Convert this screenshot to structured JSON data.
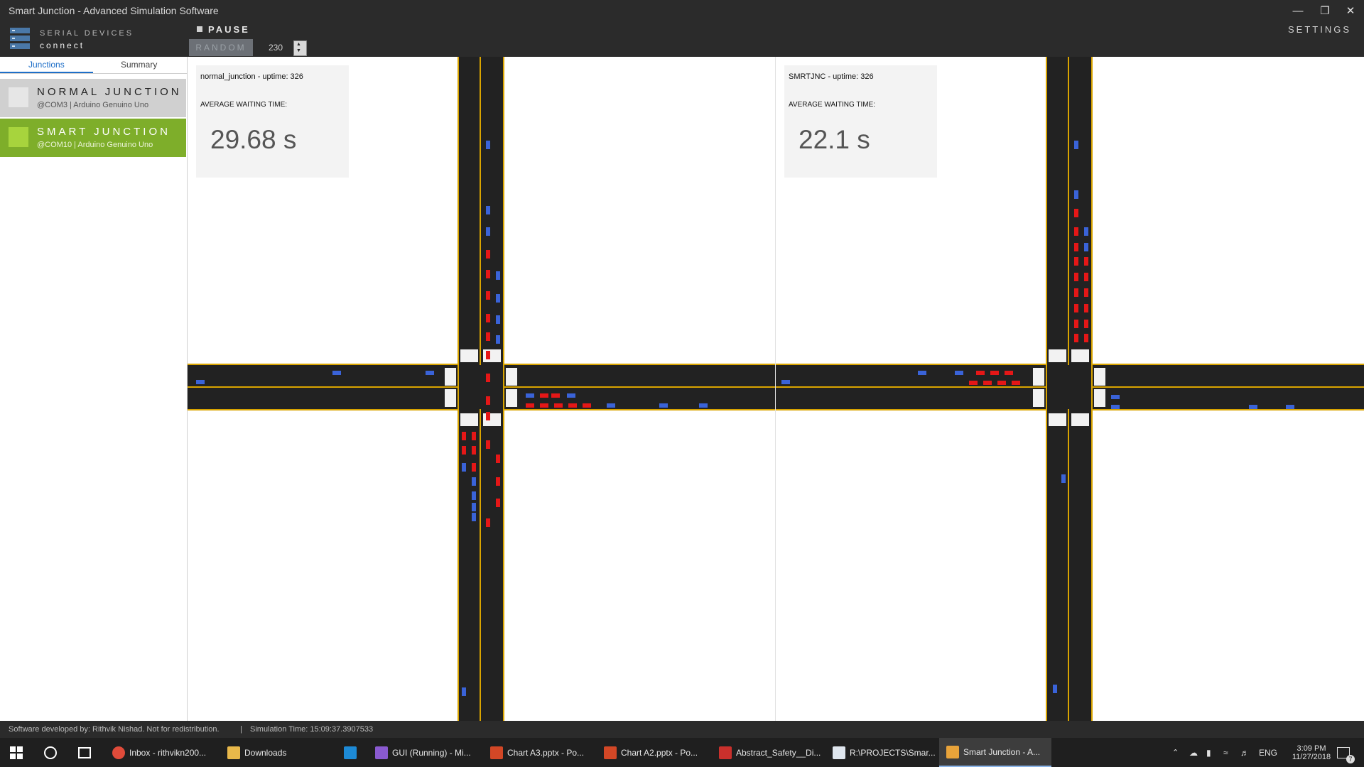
{
  "window": {
    "title": "Smart Junction - Advanced Simulation Software"
  },
  "toolbar": {
    "serial_label": "SERIAL DEVICES",
    "connect_label": "connect",
    "pause_label": "PAUSE",
    "random_label": "RANDOM",
    "count_value": "230",
    "settings_label": "SETTINGS"
  },
  "sidebar": {
    "tabs": [
      {
        "label": "Junctions"
      },
      {
        "label": "Summary"
      }
    ],
    "junctions": [
      {
        "name": "NORMAL JUNCTION",
        "subtitle": "@COM3 | Arduino Genuino Uno"
      },
      {
        "name": "SMART JUNCTION",
        "subtitle": "@COM10 | Arduino Genuino Uno"
      }
    ]
  },
  "panels": [
    {
      "uptime": "normal_junction - uptime: 326",
      "avg_label": "AVERAGE WAITING TIME:",
      "value": "29.68 s"
    },
    {
      "uptime": "SMRTJNC - uptime: 326",
      "avg_label": "AVERAGE WAITING TIME:",
      "value": "22.1 s"
    }
  ],
  "statusbar": {
    "dev_text": "Software developed by: Rithvik Nishad. Not for redistribution.",
    "separator": "|",
    "sim_time": "Simulation Time:  15:09:37.3907533"
  },
  "taskbar": {
    "items": [
      {
        "label": "Inbox - rithvikn200...",
        "icon": "chrome-icon"
      },
      {
        "label": "Downloads",
        "icon": "folder-icon"
      },
      {
        "label": "",
        "icon": "vscode-icon"
      },
      {
        "label": "GUI (Running) - Mi...",
        "icon": "visual-studio-icon"
      },
      {
        "label": "Chart A3.pptx - Po...",
        "icon": "powerpoint-icon"
      },
      {
        "label": "Chart A2.pptx - Po...",
        "icon": "powerpoint-icon"
      },
      {
        "label": "Abstract_Safety__Di...",
        "icon": "pdf-icon"
      },
      {
        "label": "R:\\PROJECTS\\Smar...",
        "icon": "window-icon"
      },
      {
        "label": "Smart Junction - A...",
        "icon": "app-icon"
      }
    ],
    "language": "ENG",
    "time": "3:09 PM",
    "date": "11/27/2018",
    "notifications": "7"
  },
  "colors": {
    "dark": "#2b2b2b",
    "road": "#222222",
    "lane_line": "#d9a400",
    "car_waiting": "#e51717",
    "car_moving": "#3a63d8",
    "smart_selected": "#7eae2a",
    "normal_bg": "#d0d0d0",
    "accent_blue": "#1e6fc8"
  }
}
